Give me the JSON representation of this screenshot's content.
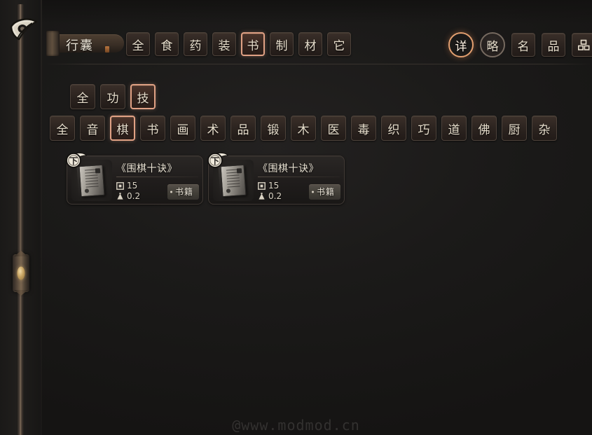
{
  "window": {
    "title": "行囊",
    "watermark": "@www.modmod.cn"
  },
  "top_tabs": [
    {
      "label": "全",
      "selected": false
    },
    {
      "label": "食",
      "selected": false
    },
    {
      "label": "药",
      "selected": false
    },
    {
      "label": "装",
      "selected": false
    },
    {
      "label": "书",
      "selected": true
    },
    {
      "label": "制",
      "selected": false
    },
    {
      "label": "材",
      "selected": false
    },
    {
      "label": "它",
      "selected": false
    }
  ],
  "view_controls": [
    {
      "label": "详",
      "type": "circle",
      "active": true
    },
    {
      "label": "略",
      "type": "circle",
      "active": false
    },
    {
      "label": "名",
      "type": "square",
      "active": false
    },
    {
      "label": "品",
      "type": "square",
      "active": false
    },
    {
      "label": "",
      "icon": "grid-icon",
      "type": "square",
      "active": false
    }
  ],
  "type_filters": [
    {
      "label": "全",
      "selected": false
    },
    {
      "label": "功",
      "selected": false
    },
    {
      "label": "技",
      "selected": true
    }
  ],
  "skill_filters": [
    {
      "label": "全",
      "selected": false
    },
    {
      "label": "音",
      "selected": false
    },
    {
      "label": "棋",
      "selected": true
    },
    {
      "label": "书",
      "selected": false
    },
    {
      "label": "画",
      "selected": false
    },
    {
      "label": "术",
      "selected": false
    },
    {
      "label": "品",
      "selected": false
    },
    {
      "label": "锻",
      "selected": false
    },
    {
      "label": "木",
      "selected": false
    },
    {
      "label": "医",
      "selected": false
    },
    {
      "label": "毒",
      "selected": false
    },
    {
      "label": "织",
      "selected": false
    },
    {
      "label": "巧",
      "selected": false
    },
    {
      "label": "道",
      "selected": false
    },
    {
      "label": "佛",
      "selected": false
    },
    {
      "label": "厨",
      "selected": false
    },
    {
      "label": "杂",
      "selected": false
    }
  ],
  "items": [
    {
      "name": "《围棋十诀》",
      "grade": "下",
      "quantity": "15",
      "weight": "0.2",
      "tag": "书籍",
      "icon": "book-icon"
    },
    {
      "name": "《围棋十诀》",
      "grade": "下",
      "quantity": "15",
      "weight": "0.2",
      "tag": "书籍",
      "icon": "book-icon"
    }
  ],
  "colors": {
    "accent": "#e0a184",
    "accent_fill": "#b5663a",
    "panel_bg": "#1b1a19",
    "button_border": "#4d423a",
    "text": "#e6ddcb",
    "gem": "#c8a463"
  }
}
